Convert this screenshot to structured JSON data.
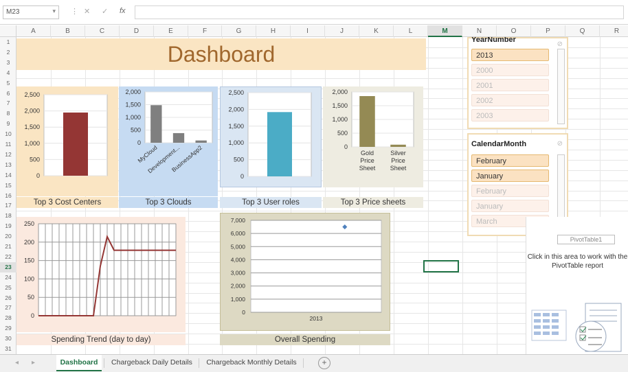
{
  "formula_bar": {
    "name_box": "M23",
    "fx_symbol": "fx",
    "cancel_symbol": "✕",
    "confirm_symbol": "✓",
    "value": ""
  },
  "columns": [
    "A",
    "B",
    "C",
    "D",
    "E",
    "F",
    "G",
    "H",
    "I",
    "J",
    "K",
    "L",
    "M",
    "N",
    "O",
    "P",
    "Q",
    "R"
  ],
  "selected_column": "M",
  "rows": [
    "1",
    "2",
    "3",
    "4",
    "5",
    "6",
    "7",
    "8",
    "9",
    "10",
    "11",
    "12",
    "13",
    "14",
    "15",
    "16",
    "17",
    "18",
    "19",
    "20",
    "21",
    "22",
    "23",
    "24",
    "25",
    "26",
    "27",
    "28",
    "29",
    "30",
    "31"
  ],
  "selected_row": "23",
  "dashboard": {
    "title": "Dashboard",
    "labels": {
      "cost_centers": "Top 3 Cost Centers",
      "clouds": "Top 3 Clouds",
      "user_roles": "Top 3 User roles",
      "price_sheets": "Top 3 Price sheets",
      "trend": "Spending Trend (day to day)",
      "overall": "Overall Spending"
    }
  },
  "chart_data": [
    {
      "type": "bar",
      "id": "cost_centers",
      "categories": [
        ""
      ],
      "values": [
        1950
      ],
      "ylim": [
        0,
        2500
      ],
      "yticks": [
        "0",
        "500",
        "1,000",
        "1,500",
        "2,000",
        "2,500"
      ],
      "color": "#943634"
    },
    {
      "type": "bar",
      "id": "clouds",
      "categories": [
        "MyCloud",
        "Development...",
        "BusinessApp2"
      ],
      "values": [
        1480,
        380,
        90
      ],
      "ylim": [
        0,
        2000
      ],
      "yticks": [
        "0",
        "500",
        "1,000",
        "1,500",
        "2,000"
      ],
      "color": "#7f7f7f"
    },
    {
      "type": "bar",
      "id": "user_roles",
      "categories": [
        ""
      ],
      "values": [
        1920
      ],
      "ylim": [
        0,
        2500
      ],
      "yticks": [
        "0",
        "500",
        "1,000",
        "1,500",
        "2,000",
        "2,500"
      ],
      "color": "#4bacc6"
    },
    {
      "type": "bar",
      "id": "price_sheets",
      "categories": [
        "Gold Price Sheet",
        "Silver Price Sheet"
      ],
      "values": [
        1850,
        80
      ],
      "ylim": [
        0,
        2000
      ],
      "yticks": [
        "0",
        "500",
        "1,000",
        "1,500",
        "2,000"
      ],
      "color": "#948a54"
    },
    {
      "type": "line",
      "id": "trend",
      "values": [
        0,
        0,
        0,
        0,
        0,
        0,
        0,
        0,
        0,
        135,
        215,
        178,
        178,
        178,
        178,
        178,
        178,
        178,
        178,
        178,
        178
      ],
      "ylim": [
        0,
        250
      ],
      "yticks": [
        "0",
        "50",
        "100",
        "150",
        "200",
        "250"
      ],
      "color": "#943634"
    },
    {
      "type": "scatter",
      "id": "overall",
      "categories": [
        "2013"
      ],
      "values": [
        6500
      ],
      "ylim": [
        0,
        7000
      ],
      "yticks": [
        "0",
        "1,000",
        "2,000",
        "3,000",
        "4,000",
        "5,000",
        "6,000",
        "7,000"
      ],
      "color": "#4f81bd"
    }
  ],
  "slicers": {
    "year": {
      "header": "YearNumber",
      "items": [
        {
          "label": "2013",
          "state": "on"
        },
        {
          "label": "2000",
          "state": "off"
        },
        {
          "label": "2001",
          "state": "off"
        },
        {
          "label": "2002",
          "state": "off"
        },
        {
          "label": "2003",
          "state": "off"
        }
      ]
    },
    "month": {
      "header": "CalendarMonth",
      "items": [
        {
          "label": "February",
          "state": "on"
        },
        {
          "label": "January",
          "state": "on"
        },
        {
          "label": "February",
          "state": "off"
        },
        {
          "label": "January",
          "state": "off"
        },
        {
          "label": "March",
          "state": "off"
        }
      ]
    }
  },
  "pivot": {
    "name": "PivotTable1",
    "message": "Click in this area to work with the PivotTable report"
  },
  "sheet_tabs": [
    "Dashboard",
    "Chargeback Daily Details",
    "Chargeback Monthly Details"
  ],
  "active_tab": "Dashboard",
  "add_sheet": "+"
}
